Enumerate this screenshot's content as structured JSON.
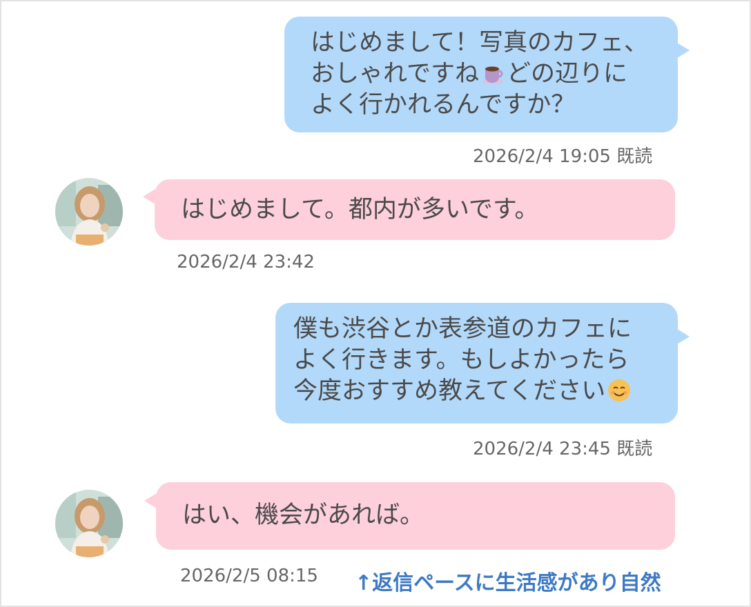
{
  "messages": [
    {
      "sender": "me",
      "text_before_emoji": "はじめまして！写真のカフェ、\nおしゃれですね",
      "emoji": "coffee-emoji",
      "text_after_emoji": "どの辺りに\nよく行かれるんですか？",
      "timestamp": "2026/2/4 19:05",
      "read_status": "既読"
    },
    {
      "sender": "them",
      "text": "はじめまして。都内が多いです。",
      "timestamp": "2026/2/4 23:42",
      "avatar": "profile-photo-avatar"
    },
    {
      "sender": "me",
      "text_before_emoji": "僕も渋谷とか表参道のカフェに\nよく行きます。もしよかったら\n今度おすすめ教えてください",
      "emoji": "smiling-face-emoji",
      "text_after_emoji": "",
      "timestamp": "2026/2/4 23:45",
      "read_status": "既読"
    },
    {
      "sender": "them",
      "text": "はい、機会があれば。",
      "timestamp": "2026/2/5 08:15",
      "avatar": "profile-photo-avatar"
    }
  ],
  "annotation": {
    "text": "↑返信ペースに生活感があり自然"
  },
  "colors": {
    "my_bubble": "#b3d9fa",
    "their_bubble": "#fdd0dc",
    "annotation": "#3d79c4",
    "text": "#4a4a4a",
    "timestamp": "#666666"
  }
}
